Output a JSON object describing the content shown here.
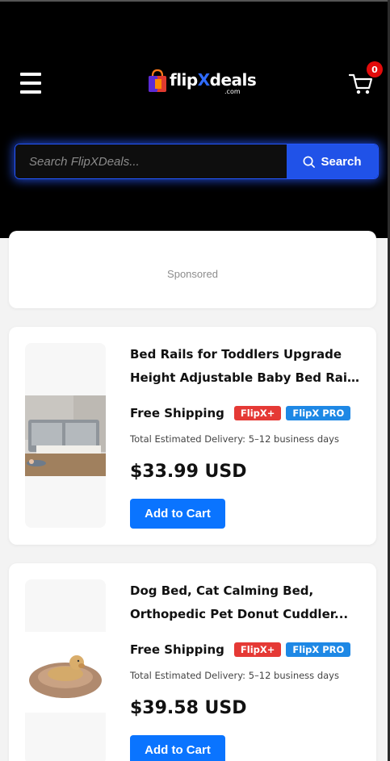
{
  "header": {
    "logo": {
      "brand_a": "flip",
      "brand_x": "X",
      "brand_b": "deals",
      "suffix": ".com"
    },
    "cart_count": "0",
    "search": {
      "placeholder": "Search FlipXDeals...",
      "button_label": "Search"
    }
  },
  "sponsored": {
    "label": "Sponsored"
  },
  "products": [
    {
      "title_line1": "Bed Rails for Toddlers Upgrade",
      "title_line2": "Height Adjustable Baby Bed Rail...",
      "shipping": "Free Shipping",
      "tag_plus": "FlipX+",
      "tag_pro": "FlipX PRO",
      "delivery": "Total Estimated Delivery: 5–12 business days",
      "price": "$33.99 USD",
      "button": "Add to Cart",
      "image_icon": "bed-rail-product-image"
    },
    {
      "title_line1": "Dog Bed, Cat Calming Bed,",
      "title_line2": "Orthopedic Pet Donut Cuddler...",
      "shipping": "Free Shipping",
      "tag_plus": "FlipX+",
      "tag_pro": "FlipX PRO",
      "delivery": "Total Estimated Delivery: 5–12 business days",
      "price": "$39.58 USD",
      "button": "Add to Cart",
      "image_icon": "pet-bed-product-image"
    }
  ],
  "colors": {
    "header_bg": "#000000",
    "search_button": "#2052e8",
    "add_to_cart": "#0a74ff",
    "tag_plus": "#e53935",
    "tag_pro": "#1e88e5",
    "cart_badge": "#e30b0b"
  }
}
